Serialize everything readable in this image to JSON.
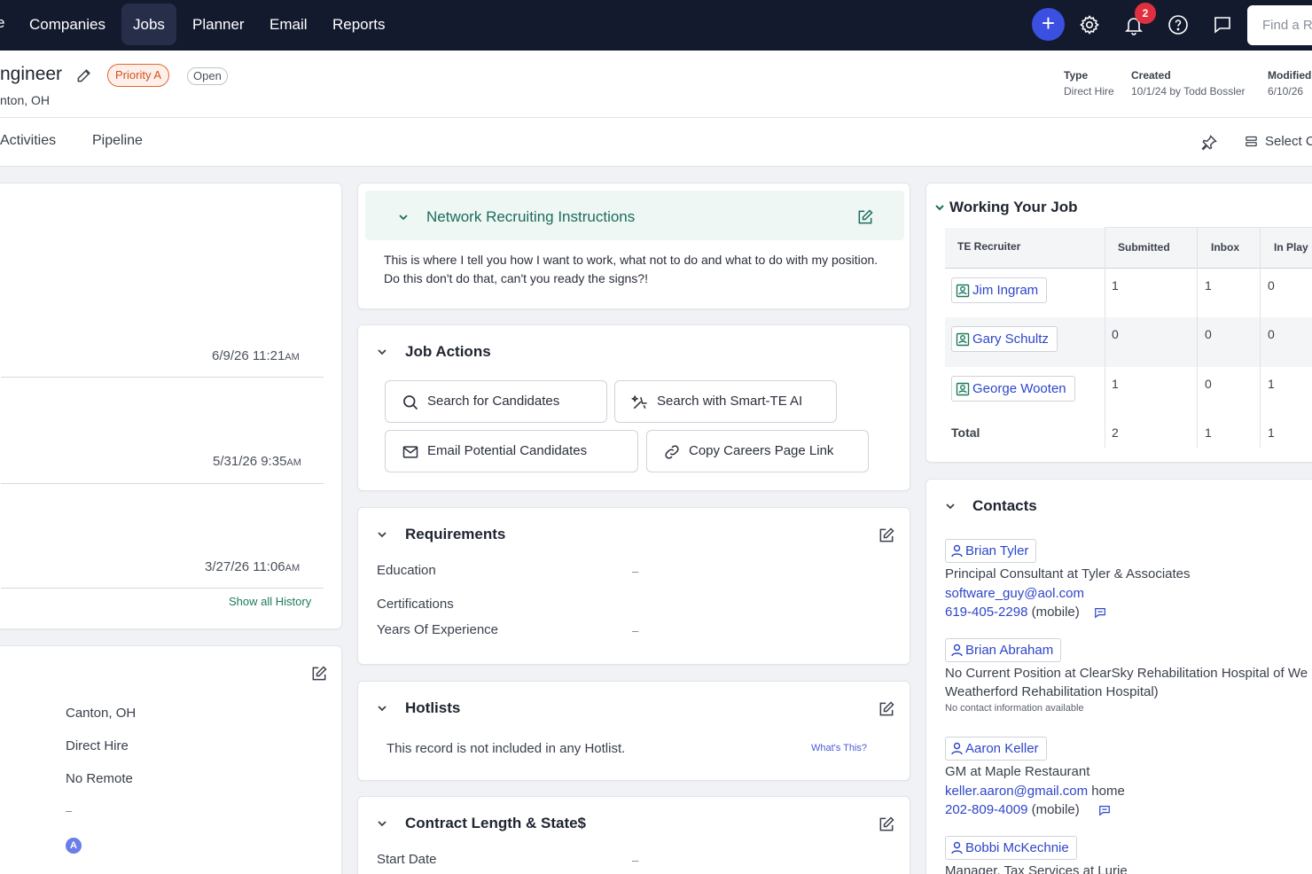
{
  "nav": {
    "items": [
      "Companies",
      "Jobs",
      "Planner",
      "Email",
      "Reports"
    ],
    "active": "Jobs",
    "notification_count": "2",
    "search_placeholder": "Find a Re"
  },
  "header": {
    "title": "ngineer",
    "priority": "Priority A",
    "status": "Open",
    "location": "nton, OH",
    "meta": [
      {
        "label": "Type",
        "value": "Direct Hire"
      },
      {
        "label": "Created",
        "value": "10/1/24 by Todd Bossler"
      },
      {
        "label": "Modified",
        "value": "6/10/26"
      }
    ]
  },
  "tabs": {
    "items": [
      "Activities",
      "Pipeline"
    ],
    "select_label": "Select C"
  },
  "history": {
    "dates": [
      {
        "date": "6/9/26 11:21",
        "ampm": "AM"
      },
      {
        "date": "5/31/26 9:35",
        "ampm": "AM"
      },
      {
        "date": "3/27/26 11:06",
        "ampm": "AM"
      }
    ],
    "show_all": "Show all History"
  },
  "details": {
    "values": [
      "Canton, OH",
      "Direct Hire",
      "No Remote",
      "–"
    ],
    "badge": "A"
  },
  "network": {
    "title": "Network Recruiting Instructions",
    "body": "This is where I tell you how I want to work, what not to do and what to do with my position.   Do this don't do that, can't you ready the signs?!"
  },
  "job_actions": {
    "title": "Job Actions",
    "buttons": [
      "Search for Candidates",
      "Search with Smart-TE AI",
      "Email Potential Candidates",
      "Copy Careers Page Link"
    ]
  },
  "requirements": {
    "title": "Requirements",
    "rows": [
      {
        "label": "Education",
        "value": "–"
      },
      {
        "label": "Certifications",
        "value": ""
      },
      {
        "label": "Years Of Experience",
        "value": "–"
      }
    ]
  },
  "hotlists": {
    "title": "Hotlists",
    "body": "This record is not included in any Hotlist.",
    "help": "What's This?"
  },
  "contract": {
    "title": "Contract Length & State$",
    "rows": [
      {
        "label": "Start Date",
        "value": "–"
      }
    ]
  },
  "working": {
    "title": "Working Your Job",
    "headers": [
      "TE Recruiter",
      "Submitted",
      "Inbox",
      "In Play"
    ],
    "rows": [
      {
        "name": "Jim Ingram",
        "submitted": "1",
        "inbox": "1",
        "inplay": "0"
      },
      {
        "name": "Gary Schultz",
        "submitted": "0",
        "inbox": "0",
        "inplay": "0"
      },
      {
        "name": "George Wooten",
        "submitted": "1",
        "inbox": "0",
        "inplay": "1"
      }
    ],
    "total": {
      "label": "Total",
      "submitted": "2",
      "inbox": "1",
      "inplay": "1"
    }
  },
  "contacts": {
    "title": "Contacts",
    "items": [
      {
        "name": "Brian Tyler",
        "line1": "Principal Consultant at Tyler & Associates",
        "email": "software_guy@aol.com",
        "email_suffix": "",
        "phone": "619-405-2298",
        "phone_suffix": " (mobile)"
      },
      {
        "name": "Brian Abraham",
        "line1": "No Current Position at ClearSky Rehabilitation Hospital of We",
        "line2": "Weatherford Rehabilitation Hospital)",
        "note": "No contact information available"
      },
      {
        "name": "Aaron Keller",
        "line1": "GM at Maple Restaurant",
        "email": "keller.aaron@gmail.com",
        "email_suffix": " home",
        "phone": "202-809-4009",
        "phone_suffix": " (mobile)"
      },
      {
        "name": "Bobbi McKechnie",
        "line1": "Manager, Tax Services at Lurie"
      }
    ]
  },
  "colors": {
    "nav_bg": "#141a2e",
    "accent": "#3b50e0",
    "link": "#2d46c9",
    "teal": "#1d6b5e",
    "priority": "#e8642c",
    "badge": "#e0303f"
  }
}
